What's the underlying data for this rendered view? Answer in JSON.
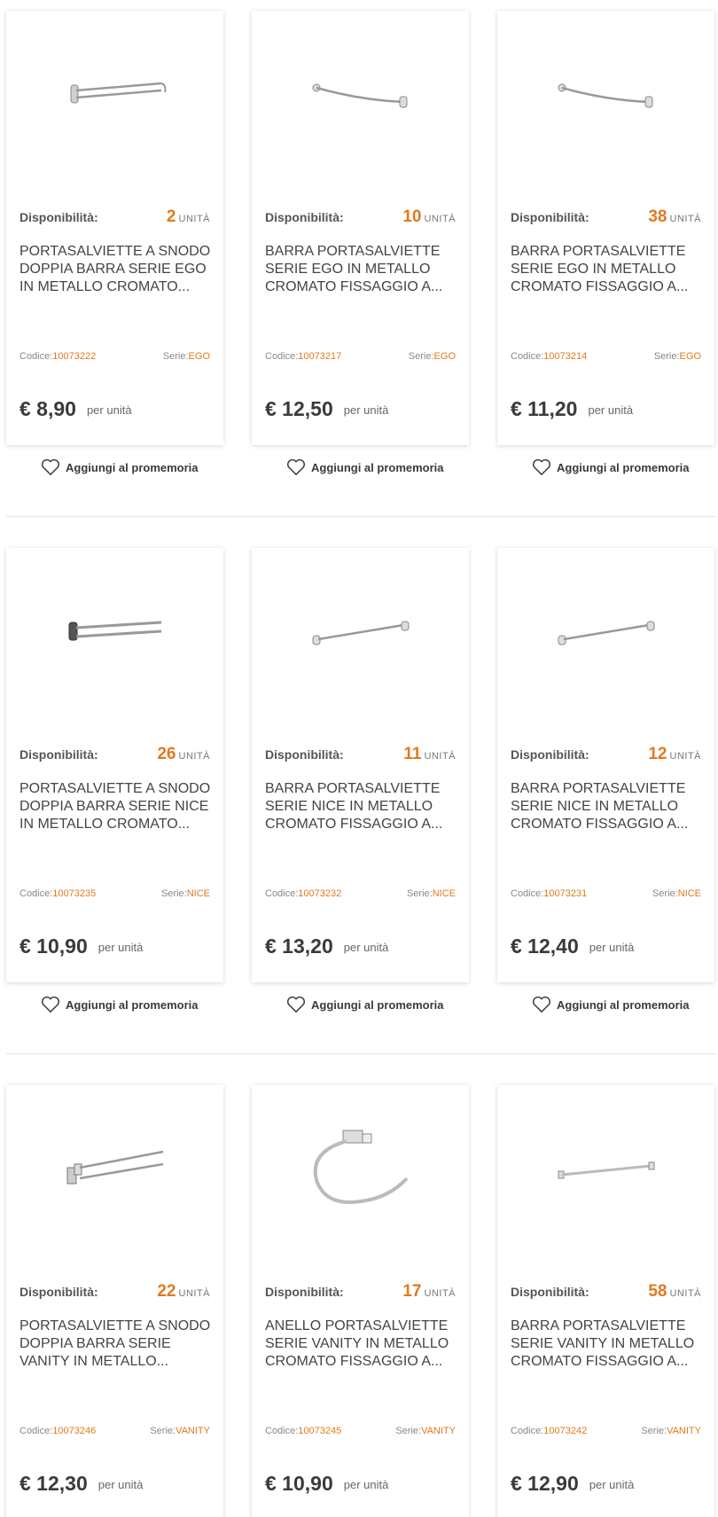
{
  "labels": {
    "availability": "Disponibilità:",
    "unit": "UNITÀ",
    "code": "Codice:",
    "series": "Serie:",
    "per_unit": "per unità",
    "wishlist": "Aggiungi al promemoria"
  },
  "products": [
    {
      "qty": "2",
      "title": "PORTASALVIETTE A SNODO DOPPIA BARRA SERIE EGO IN METALLO CROMATO...",
      "code": "10073222",
      "series": "EGO",
      "price": "€ 8,90",
      "icon": "double-swivel-towel-bar-image"
    },
    {
      "qty": "10",
      "title": "BARRA PORTASALVIETTE SERIE EGO IN METALLO CROMATO FISSAGGIO A...",
      "code": "10073217",
      "series": "EGO",
      "price": "€ 12,50",
      "icon": "towel-bar-image"
    },
    {
      "qty": "38",
      "title": "BARRA PORTASALVIETTE SERIE EGO IN METALLO CROMATO FISSAGGIO A...",
      "code": "10073214",
      "series": "EGO",
      "price": "€ 11,20",
      "icon": "towel-bar-image"
    },
    {
      "qty": "26",
      "title": "PORTASALVIETTE A SNODO DOPPIA BARRA SERIE NICE IN METALLO CROMATO...",
      "code": "10073235",
      "series": "NICE",
      "price": "€ 10,90",
      "icon": "double-swivel-towel-bar-image"
    },
    {
      "qty": "11",
      "title": "BARRA PORTASALVIETTE SERIE NICE IN METALLO CROMATO FISSAGGIO A...",
      "code": "10073232",
      "series": "NICE",
      "price": "€ 13,20",
      "icon": "towel-bar-image"
    },
    {
      "qty": "12",
      "title": "BARRA PORTASALVIETTE SERIE NICE IN METALLO CROMATO FISSAGGIO A...",
      "code": "10073231",
      "series": "NICE",
      "price": "€ 12,40",
      "icon": "towel-bar-image"
    },
    {
      "qty": "22",
      "title": "PORTASALVIETTE A SNODO DOPPIA BARRA SERIE VANITY IN METALLO...",
      "code": "10073246",
      "series": "VANITY",
      "price": "€ 12,30",
      "icon": "double-swivel-towel-bar-image"
    },
    {
      "qty": "17",
      "title": "ANELLO PORTASALVIETTE SERIE VANITY IN METALLO CROMATO FISSAGGIO A...",
      "code": "10073245",
      "series": "VANITY",
      "price": "€ 10,90",
      "icon": "towel-ring-image"
    },
    {
      "qty": "58",
      "title": "BARRA PORTASALVIETTE SERIE VANITY IN METALLO CROMATO FISSAGGIO A...",
      "code": "10073242",
      "series": "VANITY",
      "price": "€ 12,90",
      "icon": "towel-bar-image"
    }
  ],
  "colors": {
    "accent": "#e07a1e",
    "text": "#3a3a3a"
  }
}
